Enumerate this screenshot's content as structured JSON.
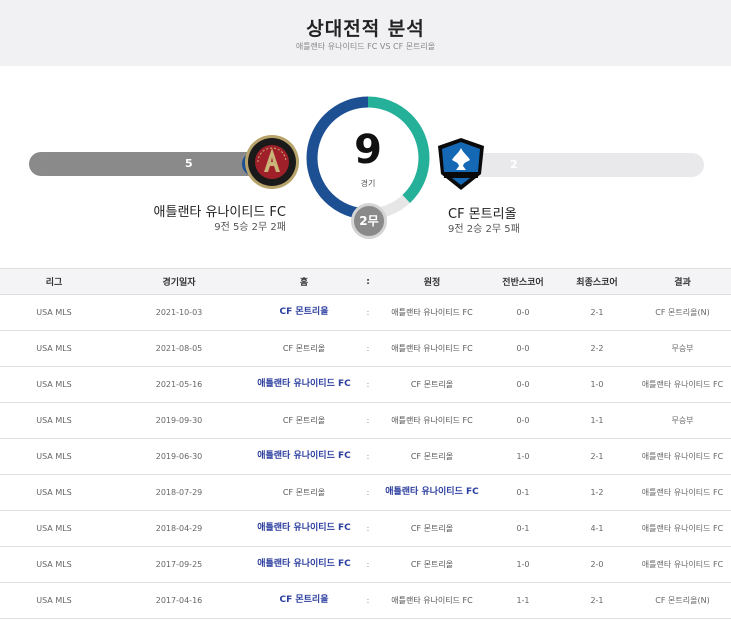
{
  "header": {
    "title": "상대전적 분석",
    "subtitle": "애틀랜타 유나이티드 FC VS CF 몬트리올"
  },
  "summary": {
    "total_games": "9",
    "games_label": "경기",
    "draws_label": "2무",
    "home": {
      "name": "애틀랜타 유나이티드 FC",
      "record": "9전 5승 2무 2패",
      "wins": "5",
      "win_share": 0.556
    },
    "away": {
      "name": "CF 몬트리올",
      "record": "9전 2승 2무 5패",
      "wins": "2",
      "win_share": 0.222
    }
  },
  "colors": {
    "home": "#1d4f93",
    "away": "#25b199",
    "draw": "#8a8a8a"
  },
  "table": {
    "headers": [
      "리그",
      "경기일자",
      "홈",
      ":",
      "원정",
      "전반스코어",
      "최종스코어",
      "결과"
    ],
    "rows": [
      {
        "league": "USA MLS",
        "date": "2021-10-03",
        "home": "CF 몬트리올",
        "home_win": true,
        "sep": ":",
        "away": "애틀랜타 유나이티드 FC",
        "away_win": false,
        "half": "0-0",
        "final": "2-1",
        "result": "CF 몬트리올(N)"
      },
      {
        "league": "USA MLS",
        "date": "2021-08-05",
        "home": "CF 몬트리올",
        "home_win": false,
        "sep": ":",
        "away": "애틀랜타 유나이티드 FC",
        "away_win": false,
        "half": "0-0",
        "final": "2-2",
        "result": "무승부"
      },
      {
        "league": "USA MLS",
        "date": "2021-05-16",
        "home": "애틀랜타 유나이티드 FC",
        "home_win": true,
        "sep": ":",
        "away": "CF 몬트리올",
        "away_win": false,
        "half": "0-0",
        "final": "1-0",
        "result": "애틀랜타 유나이티드 FC"
      },
      {
        "league": "USA MLS",
        "date": "2019-09-30",
        "home": "CF 몬트리올",
        "home_win": false,
        "sep": ":",
        "away": "애틀랜타 유나이티드 FC",
        "away_win": false,
        "half": "0-0",
        "final": "1-1",
        "result": "무승부"
      },
      {
        "league": "USA MLS",
        "date": "2019-06-30",
        "home": "애틀랜타 유나이티드 FC",
        "home_win": true,
        "sep": ":",
        "away": "CF 몬트리올",
        "away_win": false,
        "half": "1-0",
        "final": "2-1",
        "result": "애틀랜타 유나이티드 FC"
      },
      {
        "league": "USA MLS",
        "date": "2018-07-29",
        "home": "CF 몬트리올",
        "home_win": false,
        "sep": ":",
        "away": "애틀랜타 유나이티드 FC",
        "away_win": true,
        "half": "0-1",
        "final": "1-2",
        "result": "애틀랜타 유나이티드 FC"
      },
      {
        "league": "USA MLS",
        "date": "2018-04-29",
        "home": "애틀랜타 유나이티드 FC",
        "home_win": true,
        "sep": ":",
        "away": "CF 몬트리올",
        "away_win": false,
        "half": "0-1",
        "final": "4-1",
        "result": "애틀랜타 유나이티드 FC"
      },
      {
        "league": "USA MLS",
        "date": "2017-09-25",
        "home": "애틀랜타 유나이티드 FC",
        "home_win": true,
        "sep": ":",
        "away": "CF 몬트리올",
        "away_win": false,
        "half": "1-0",
        "final": "2-0",
        "result": "애틀랜타 유나이티드 FC"
      },
      {
        "league": "USA MLS",
        "date": "2017-04-16",
        "home": "CF 몬트리올",
        "home_win": true,
        "sep": ":",
        "away": "애틀랜타 유나이티드 FC",
        "away_win": false,
        "half": "1-1",
        "final": "2-1",
        "result": "CF 몬트리올(N)"
      }
    ]
  }
}
